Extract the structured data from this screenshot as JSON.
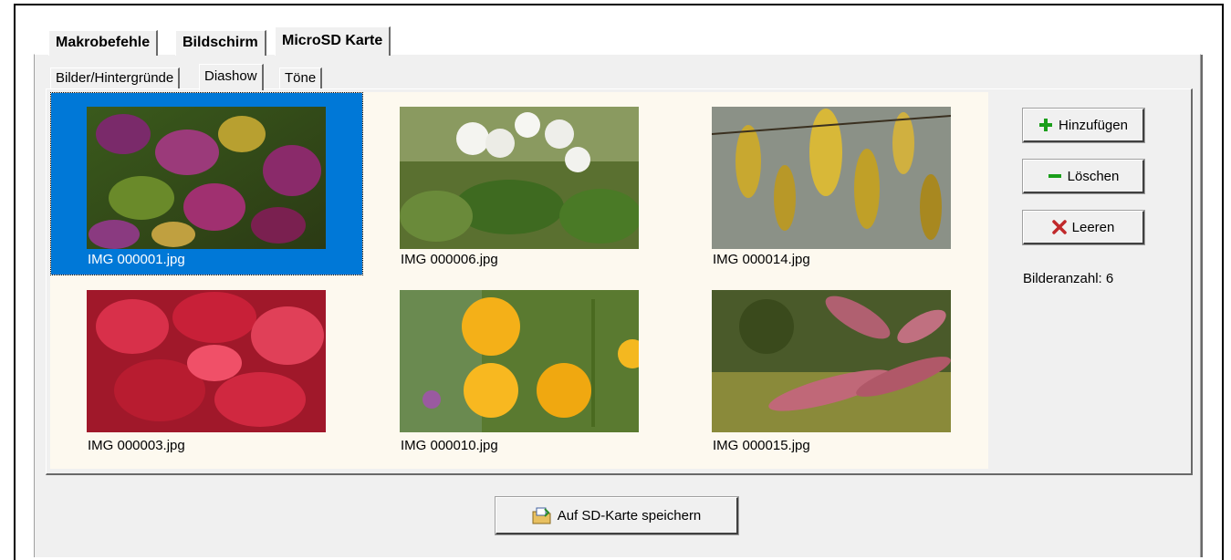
{
  "main_tabs": [
    {
      "label": "Makrobefehle",
      "active": false
    },
    {
      "label": "Bildschirm",
      "active": false
    },
    {
      "label": "MicroSD Karte",
      "active": true
    }
  ],
  "sub_tabs": [
    {
      "label": "Bilder/Hintergründe",
      "active": false
    },
    {
      "label": "Diashow",
      "active": true
    },
    {
      "label": "Töne",
      "active": false
    }
  ],
  "images": [
    {
      "name": "IMG 000001.jpg",
      "selected": true
    },
    {
      "name": "IMG 000006.jpg",
      "selected": false
    },
    {
      "name": "IMG 000014.jpg",
      "selected": false
    },
    {
      "name": "IMG 000003.jpg",
      "selected": false
    },
    {
      "name": "IMG 000010.jpg",
      "selected": false
    },
    {
      "name": "IMG 000015.jpg",
      "selected": false
    }
  ],
  "buttons": {
    "add_label": "Hinzufügen",
    "delete_label": "Löschen",
    "clear_label": "Leeren",
    "save_label": "Auf SD-Karte speichern"
  },
  "count_label": "Bilderanzahl: 6",
  "colors": {
    "selection": "#0078d7",
    "gallery_bg": "#fdf9ef",
    "add_icon": "#1a9e1a",
    "delete_icon": "#1a9e1a",
    "clear_icon": "#c0282a"
  },
  "icons": {
    "add": "plus-icon",
    "delete": "minus-icon",
    "clear": "x-icon",
    "save": "save-folder-icon"
  }
}
